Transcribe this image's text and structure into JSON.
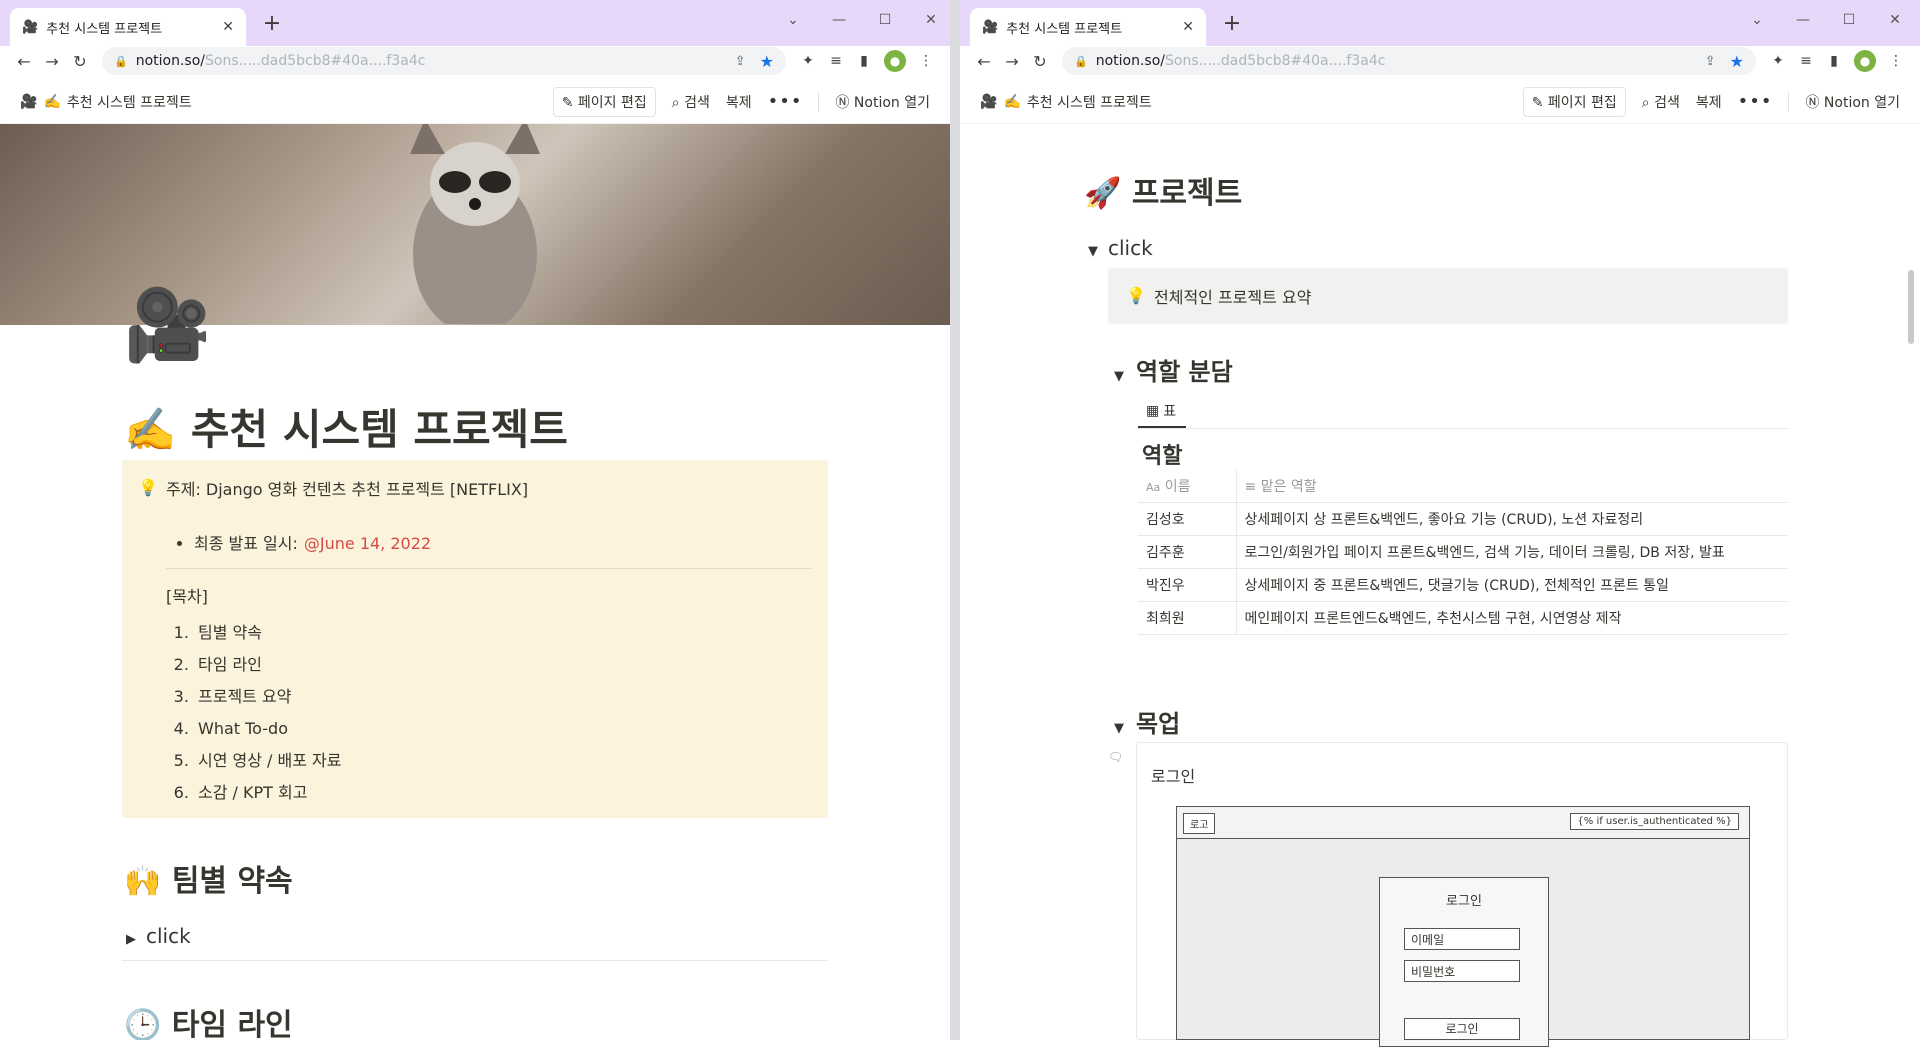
{
  "browser": {
    "tab_title": "추천 시스템 프로젝트",
    "tab_favicon": "🎥",
    "url_visible": "notion.so/",
    "url_blurred": "Sons.....dad5bcb8#40a....f3a4c",
    "new_tab": "+"
  },
  "notion_bar": {
    "breadcrumb_icon": "🎥",
    "breadcrumb_emoji": "✍️",
    "breadcrumb_title": "추천 시스템 프로젝트",
    "edit": "페이지 편집",
    "search": "검색",
    "duplicate": "복제",
    "more": "•••",
    "open_notion": "Notion 열기"
  },
  "left": {
    "page_icon": "🎥",
    "title_emoji": "✍️",
    "title": "추천 시스템 프로젝트",
    "callout": {
      "icon": "💡",
      "subject": "주제: Django 영화 컨텐츠 추천 프로젝트 [NETFLIX]",
      "final_label": "최종 발표 일시:",
      "final_date": "@June 14, 2022",
      "toc_title": "[목차]",
      "toc": [
        "팀별 약속",
        "타임 라인",
        "프로젝트 요약",
        "What To-do",
        "시연 영상 / 배포 자료",
        "소감 / KPT 회고"
      ]
    },
    "section1_emoji": "🙌",
    "section1": "팀별 약속",
    "toggle1": "click",
    "section2_emoji": "🕒",
    "section2": "타임 라인"
  },
  "right": {
    "section_emoji": "🚀",
    "section": "프로젝트",
    "toggle": "click",
    "summary_icon": "💡",
    "summary": "전체적인 프로젝트 요약",
    "roles_heading": "역할 분담",
    "view_tab": "표",
    "db_title": "역할",
    "columns": [
      "이름",
      "맡은 역할"
    ],
    "rows": [
      [
        "김성호",
        "상세페이지 상 프론트&백엔드, 좋아요 기능 (CRUD), 노션 자료정리"
      ],
      [
        "김주훈",
        "로그인/회원가입 페이지 프론트&백엔드, 검색 기능, 데이터 크롤링, DB 저장, 발표"
      ],
      [
        "박진우",
        "상세페이지 중 프론트&백엔드, 댓글기능 (CRUD), 전체적인 프론트 통일"
      ],
      [
        "최희원",
        "메인페이지 프론트엔드&백엔드, 추천시스템 구현, 시연영상 제작"
      ]
    ],
    "mockup_heading": "목업",
    "mockup_label": "로그인",
    "wire": {
      "logo": "로고",
      "auth": "{% if user.is_authenticated %}",
      "box_title": "로그인",
      "email": "이메일",
      "password": "비밀번호",
      "submit": "로그인"
    }
  },
  "colors": {
    "tab_strip": "#e7d7f8",
    "callout_yellow": "#fbf3db",
    "date_red": "#d44c47",
    "star_blue": "#1a73e8"
  }
}
